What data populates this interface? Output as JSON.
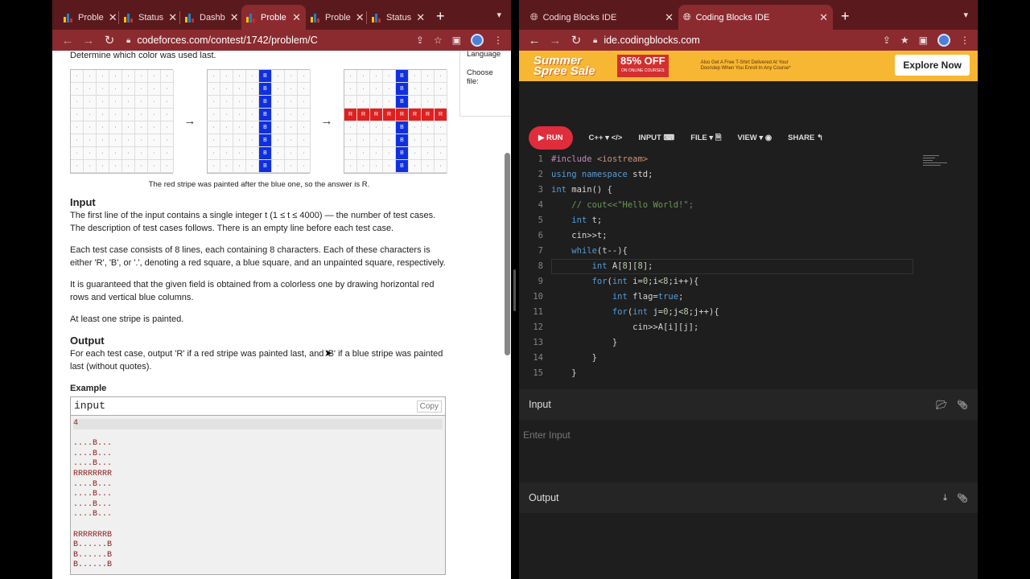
{
  "left": {
    "tabs": [
      {
        "label": "Proble",
        "active": false
      },
      {
        "label": "Status",
        "active": false
      },
      {
        "label": "Dashb",
        "active": false
      },
      {
        "label": "Proble",
        "active": true
      },
      {
        "label": "Proble",
        "active": false
      },
      {
        "label": "Status",
        "active": false
      }
    ],
    "url": "codeforces.com/contest/1742/problem/C",
    "side_panel": {
      "language": "Language",
      "choose": "Choose file:"
    },
    "problem": {
      "intro": "Determine which color was used last.",
      "caption": "The red stripe was painted after the blue one, so the answer is R.",
      "input_title": "Input",
      "input_p1": "The first line of the input contains a single integer t (1 ≤ t ≤ 4000) — the number of test cases. The description of test cases follows. There is an empty line before each test case.",
      "input_p2": "Each test case consists of 8 lines, each containing 8 characters. Each of these characters is either 'R', 'B', or '.', denoting a red square, a blue square, and an unpainted square, respectively.",
      "input_p3": "It is guaranteed that the given field is obtained from a colorless one by drawing horizontal red rows and vertical blue columns.",
      "input_p4": "At least one stripe is painted.",
      "output_title": "Output",
      "output_p1": "For each test case, output 'R' if a red stripe was painted last, and 'B' if a blue stripe was painted last (without quotes).",
      "example_label": "Example",
      "example_head": "input",
      "copy_label": "Copy",
      "example_lines": [
        "4",
        "",
        "....B...",
        "....B...",
        "....B...",
        "RRRRRRRR",
        "....B...",
        "....B...",
        "....B...",
        "....B...",
        "",
        "RRRRRRRB",
        "B......B",
        "B......B",
        "B......B"
      ]
    },
    "grids": {
      "g1": [
        "........",
        "........",
        "........",
        "........",
        "........",
        "........",
        "........",
        "........"
      ],
      "g2": [
        "....B...",
        "....B...",
        "....B...",
        "....B...",
        "....B...",
        "....B...",
        "....B...",
        "....B..."
      ],
      "g3": [
        "....B...",
        "....B...",
        "....B...",
        "RRRRRRRR",
        "....B...",
        "....B...",
        "....B...",
        "....B..."
      ],
      "arrow": "→"
    }
  },
  "right": {
    "tabs": [
      {
        "label": "Coding Blocks IDE",
        "active": false
      },
      {
        "label": "Coding Blocks IDE",
        "active": true
      }
    ],
    "url": "ide.codingblocks.com",
    "banner": {
      "sale": "Summer Spree Sale",
      "off": "85% OFF",
      "off_sub": "ON ONLINE COURSES",
      "promo": "Also Get A Free T-Shirt Delivered At Your Doorstep When You Enroll In Any Course*",
      "explore": "Explore Now"
    },
    "toolbar": {
      "run": "RUN",
      "lang": "C++",
      "input": "INPUT",
      "file": "FILE",
      "view": "VIEW",
      "share": "SHARE"
    },
    "input_panel": {
      "title": "Input",
      "placeholder": "Enter Input"
    },
    "output_panel": {
      "title": "Output"
    }
  }
}
